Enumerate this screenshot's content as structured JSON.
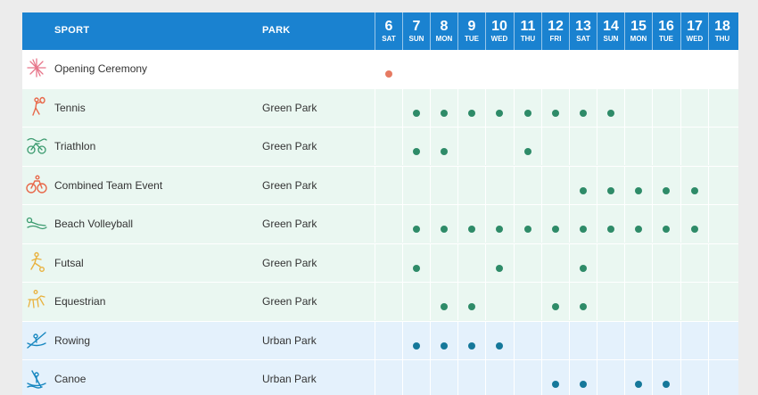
{
  "header": {
    "sport_label": "SPORT",
    "park_label": "PARK",
    "dates": [
      {
        "num": "6",
        "day": "SAT"
      },
      {
        "num": "7",
        "day": "SUN"
      },
      {
        "num": "8",
        "day": "MON"
      },
      {
        "num": "9",
        "day": "TUE"
      },
      {
        "num": "10",
        "day": "WED"
      },
      {
        "num": "11",
        "day": "THU"
      },
      {
        "num": "12",
        "day": "FRI"
      },
      {
        "num": "13",
        "day": "SAT"
      },
      {
        "num": "14",
        "day": "SUN"
      },
      {
        "num": "15",
        "day": "MON"
      },
      {
        "num": "16",
        "day": "TUE"
      },
      {
        "num": "17",
        "day": "WED"
      },
      {
        "num": "18",
        "day": "THU"
      }
    ]
  },
  "colors": {
    "header_bg": "#1a82d0",
    "green_park_row": "#eaf7f1",
    "urban_park_row": "#e4f1fc",
    "green_dot": "#2e8b68",
    "urban_dot": "#15789a",
    "ceremony_dot": "#e67a62"
  },
  "events": [
    {
      "name": "Opening Ceremony",
      "park": "",
      "icon": "fireworks-icon",
      "group": "white",
      "days": [
        "6"
      ]
    },
    {
      "name": "Tennis",
      "park": "Green Park",
      "icon": "tennis-icon",
      "group": "green",
      "days": [
        "7",
        "8",
        "9",
        "10",
        "11",
        "12",
        "13",
        "14"
      ]
    },
    {
      "name": "Triathlon",
      "park": "Green Park",
      "icon": "triathlon-icon",
      "group": "green",
      "days": [
        "7",
        "8",
        "11"
      ]
    },
    {
      "name": "Combined Team Event",
      "park": "Green Park",
      "icon": "cycling-icon",
      "group": "green",
      "days": [
        "13",
        "14",
        "15",
        "16",
        "17"
      ]
    },
    {
      "name": "Beach Volleyball",
      "park": "Green Park",
      "icon": "beach-volleyball-icon",
      "group": "green",
      "days": [
        "7",
        "8",
        "9",
        "10",
        "11",
        "12",
        "13",
        "14",
        "15",
        "16",
        "17"
      ]
    },
    {
      "name": "Futsal",
      "park": "Green Park",
      "icon": "futsal-icon",
      "group": "green",
      "days": [
        "7",
        "10",
        "13"
      ]
    },
    {
      "name": "Equestrian",
      "park": "Green Park",
      "icon": "equestrian-icon",
      "group": "green",
      "days": [
        "8",
        "9",
        "12",
        "13"
      ]
    },
    {
      "name": "Rowing",
      "park": "Urban Park",
      "icon": "rowing-icon",
      "group": "blue",
      "days": [
        "7",
        "8",
        "9",
        "10"
      ]
    },
    {
      "name": "Canoe",
      "park": "Urban Park",
      "icon": "canoe-icon",
      "group": "blue",
      "days": [
        "12",
        "13",
        "15",
        "16"
      ]
    }
  ]
}
